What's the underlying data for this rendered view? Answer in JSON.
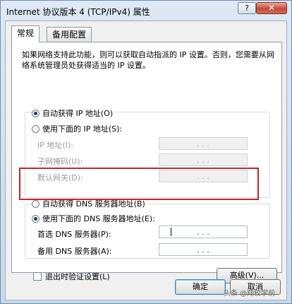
{
  "window": {
    "title": "Internet 协议版本 4 (TCP/IPv4) 属性",
    "help_label": "?",
    "close_label": "✕"
  },
  "tabs": [
    {
      "label": "常规",
      "active": true
    },
    {
      "label": "备用配置",
      "active": false
    }
  ],
  "description": "如果网络支持此功能，则可以获取自动指派的 IP 设置。否则，您需要从网络系统管理员处获得适当的 IP 设置。",
  "ip": {
    "auto_label": "自动获得 IP 地址(O)",
    "auto_selected": true,
    "manual_label": "使用下面的 IP 地址(S):",
    "manual_selected": false,
    "fields": [
      {
        "label": "IP 地址(I):",
        "value": ". . ."
      },
      {
        "label": "子网掩码(U):",
        "value": ". . ."
      },
      {
        "label": "默认网关(D):",
        "value": ". . ."
      }
    ]
  },
  "dns": {
    "auto_label": "自动获得 DNS 服务器地址(B)",
    "auto_selected": false,
    "manual_label": "使用下面的 DNS 服务器地址(E):",
    "manual_selected": true,
    "fields": [
      {
        "label": "首选 DNS 服务器(P):",
        "value": ". . ."
      },
      {
        "label": "备用 DNS 服务器(A):",
        "value": ". . ."
      }
    ]
  },
  "validate_label": "退出时验证设置(L)",
  "advanced_label": "高级(V)...",
  "ok_label": "确定",
  "cancel_label": "取消",
  "watermark": "头条 @翔校学前",
  "colors": {
    "highlight": "#c3262b",
    "close_button": "#c44a36"
  }
}
